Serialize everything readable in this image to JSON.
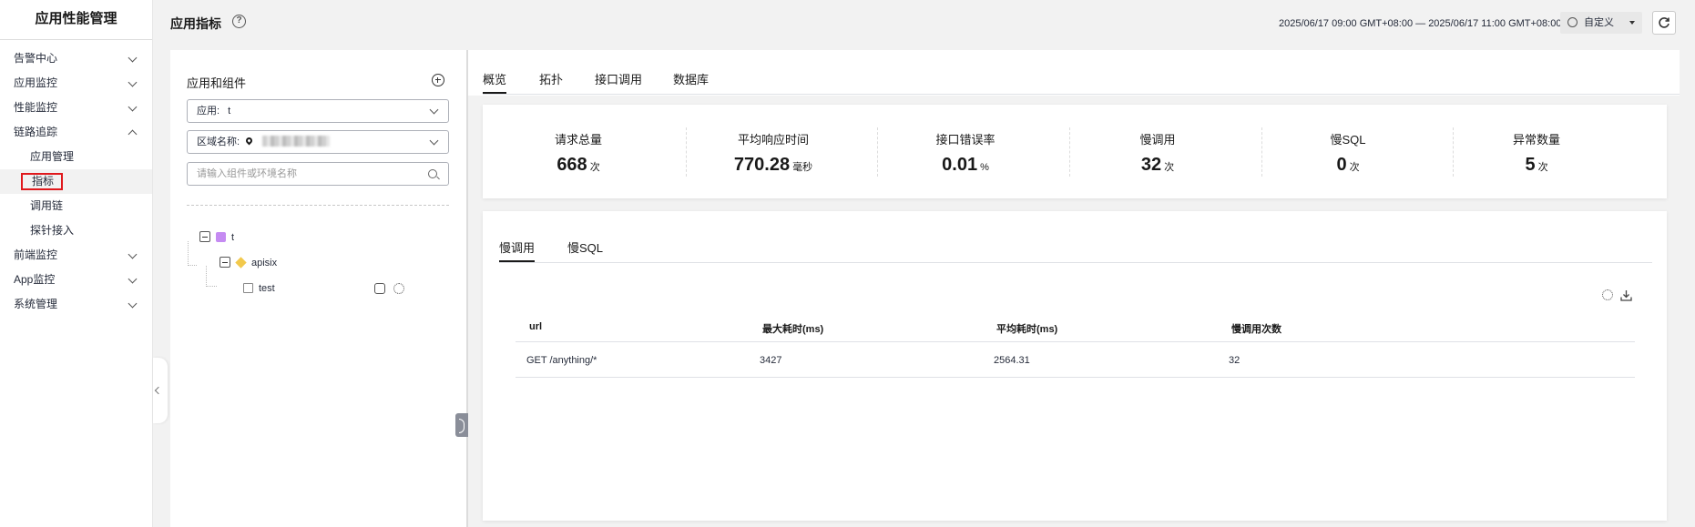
{
  "sidebar": {
    "title": "应用性能管理",
    "items": [
      {
        "label": "告警中心"
      },
      {
        "label": "应用监控"
      },
      {
        "label": "性能监控"
      },
      {
        "label": "链路追踪"
      },
      {
        "label": "前端监控"
      },
      {
        "label": "App监控"
      },
      {
        "label": "系统管理"
      }
    ],
    "sub_items": [
      {
        "label": "应用管理"
      },
      {
        "label": "指标"
      },
      {
        "label": "调用链"
      },
      {
        "label": "探针接入"
      }
    ]
  },
  "header": {
    "title": "应用指标",
    "time_range": "2025/06/17 09:00 GMT+08:00 — 2025/06/17 11:00 GMT+08:00",
    "time_mode": "自定义"
  },
  "left_panel": {
    "title": "应用和组件",
    "app_select_label": "应用:",
    "app_select_value": "t",
    "region_label": "区域名称:",
    "search_placeholder": "请输入组件或环境名称",
    "tree": {
      "app": "t",
      "component": "apisix",
      "instance": "test"
    }
  },
  "tabs": [
    "概览",
    "拓扑",
    "接口调用",
    "数据库"
  ],
  "metrics": [
    {
      "label": "请求总量",
      "value": "668",
      "unit": "次"
    },
    {
      "label": "平均响应时间",
      "value": "770.28",
      "unit": "毫秒"
    },
    {
      "label": "接口错误率",
      "value": "0.01",
      "unit": "%"
    },
    {
      "label": "慢调用",
      "value": "32",
      "unit": "次"
    },
    {
      "label": "慢SQL",
      "value": "0",
      "unit": "次"
    },
    {
      "label": "异常数量",
      "value": "5",
      "unit": "次"
    }
  ],
  "detail": {
    "sub_tabs": [
      "慢调用",
      "慢SQL"
    ],
    "columns": [
      "url",
      "最大耗时(ms)",
      "平均耗时(ms)",
      "慢调用次数"
    ],
    "rows": [
      [
        "GET /anything/*",
        "3427",
        "2564.31",
        "32"
      ]
    ]
  },
  "colors": {
    "active_highlight": "#e0191d",
    "app_icon": "#c58bf2",
    "component_icon": "#f2c94c"
  }
}
